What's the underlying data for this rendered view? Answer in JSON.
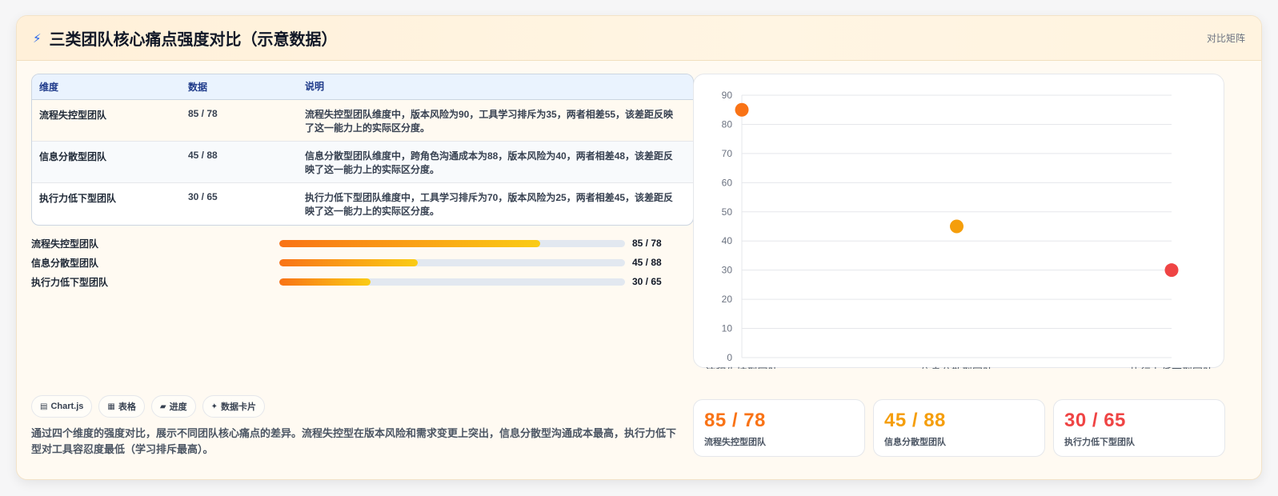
{
  "header": {
    "icon": "bolt-icon",
    "title": "三类团队核心痛点强度对比（示意数据）",
    "right_label": "对比矩阵"
  },
  "table": {
    "headers": [
      "维度",
      "数据",
      "说明"
    ],
    "rows": [
      {
        "dimension": "流程失控型团队",
        "data": "85 / 78",
        "note": "流程失控型团队维度中，版本风险为90，工具学习排斥为35，两者相差55，该差距反映了这一能力上的实际区分度。"
      },
      {
        "dimension": "信息分散型团队",
        "data": "45 / 88",
        "note": "信息分散型团队维度中，跨角色沟通成本为88，版本风险为40，两者相差48，该差距反映了这一能力上的实际区分度。"
      },
      {
        "dimension": "执行力低下型团队",
        "data": "30 / 65",
        "note": "执行力低下型团队维度中，工具学习排斥为70，版本风险为25，两者相差45，该差距反映了这一能力上的实际区分度。"
      }
    ]
  },
  "progress": [
    {
      "label": "流程失控型团队",
      "value_text": "85 / 78",
      "fraction": 0.755
    },
    {
      "label": "信息分散型团队",
      "value_text": "45 / 88",
      "fraction": 0.4
    },
    {
      "label": "执行力低下型团队",
      "value_text": "30 / 65",
      "fraction": 0.265
    }
  ],
  "chips": [
    {
      "icon": "chart-icon",
      "glyph": "▤",
      "label": "Chart.js"
    },
    {
      "icon": "table-icon",
      "glyph": "▦",
      "label": "表格"
    },
    {
      "icon": "progress-icon",
      "glyph": "▰",
      "label": "进度"
    },
    {
      "icon": "sparkle-icon",
      "glyph": "✦",
      "label": "数据卡片"
    }
  ],
  "description": "通过四个维度的强度对比，展示不同团队核心痛点的差异。流程失控型在版本风险和需求变更上突出，信息分散型沟通成本最高，执行力低下型对工具容忍度最低（学习排斥最高）。",
  "stats": [
    {
      "value": "85 / 78",
      "label": "流程失控型团队",
      "color": "#f97316"
    },
    {
      "value": "45 / 88",
      "label": "信息分散型团队",
      "color": "#f59e0b"
    },
    {
      "value": "30 / 65",
      "label": "执行力低下型团队",
      "color": "#ef4444"
    }
  ],
  "chart_data": {
    "type": "scatter",
    "categories": [
      "流程失控型团队",
      "信息分散型团队",
      "执行力低下型团队"
    ],
    "values": [
      85,
      45,
      30
    ],
    "colors": [
      "#f97316",
      "#f59e0b",
      "#ef4444"
    ],
    "ylim": [
      0,
      90
    ],
    "yticks": [
      0,
      10,
      20,
      30,
      40,
      50,
      60,
      70,
      80,
      90
    ],
    "grid": true,
    "title": "",
    "xlabel": "",
    "ylabel": ""
  }
}
